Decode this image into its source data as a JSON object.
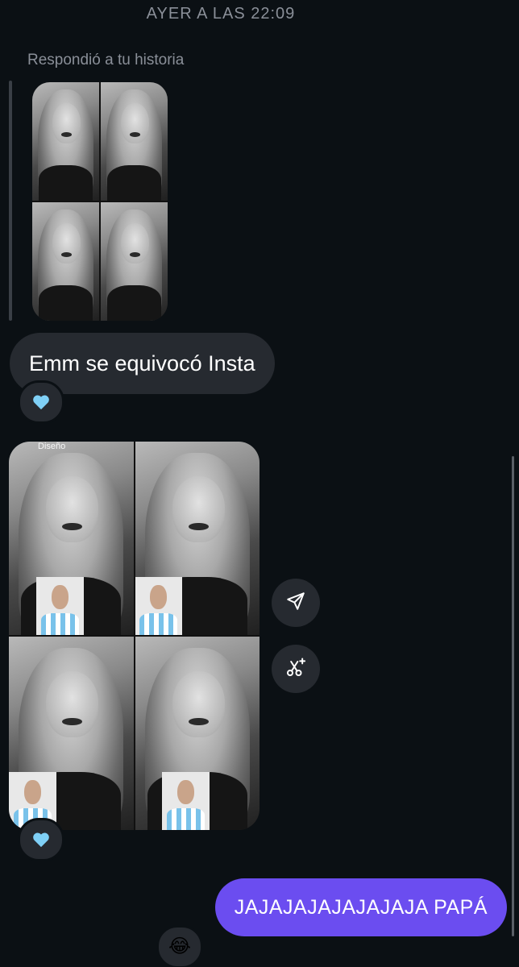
{
  "chat": {
    "timestamp": "AYER A LAS 22:09",
    "story_reply_label": "Respondió a tu historia",
    "media_watermark": "Diseño",
    "received_message": "Emm se equivocó Insta",
    "sent_message": "JAJAJAJAJAJAJAJA PAPÁ"
  },
  "reactions": {
    "first_message": "heart-blue",
    "media_message": "heart-blue",
    "sent_message": "😂"
  },
  "actions": {
    "share_icon": "paper-plane-icon",
    "remix_icon": "scissors-sparkle-icon"
  },
  "colors": {
    "background": "#0b1014",
    "received_bubble": "#262a30",
    "sent_bubble": "#6b4df0",
    "heart": "#7fd0f6"
  }
}
